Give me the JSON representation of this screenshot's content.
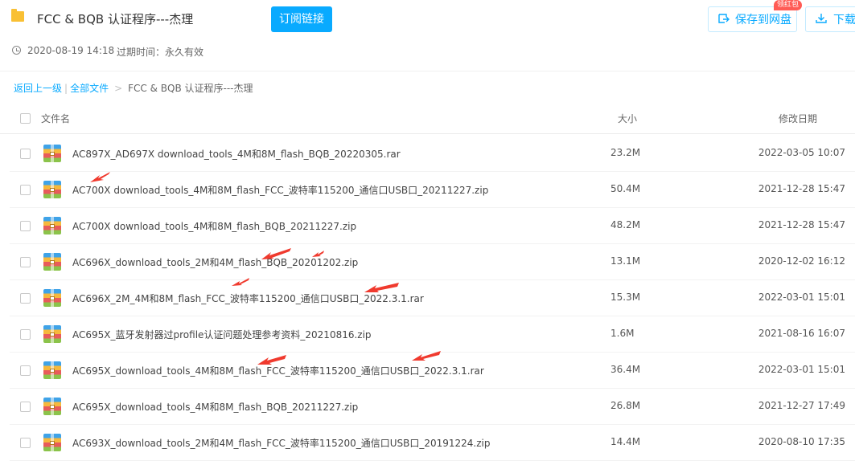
{
  "header": {
    "title": "FCC & BQB 认证程序---杰理",
    "subscribe_label": "订阅链接",
    "save_label": "保存到网盘",
    "badge_label": "领红包",
    "download_label": "下载"
  },
  "meta": {
    "share_time": "2020-08-19 14:18",
    "expire_label": "过期时间：",
    "expire_value": "永久有效"
  },
  "breadcrumb": {
    "back": "返回上一级",
    "all_files": "全部文件",
    "separator": "|",
    "arrow": ">",
    "current": "FCC & BQB 认证程序---杰理"
  },
  "columns": {
    "name": "文件名",
    "size": "大小",
    "date": "修改日期"
  },
  "files": [
    {
      "name": "AC897X_AD697X download_tools_4M和8M_flash_BQB_20220305.rar",
      "size": "23.2M",
      "date": "2022-03-05 10:07"
    },
    {
      "name": "AC700X download_tools_4M和8M_flash_FCC_波特率115200_通信口USB口_20211227.zip",
      "size": "50.4M",
      "date": "2021-12-28 15:47"
    },
    {
      "name": "AC700X download_tools_4M和8M_flash_BQB_20211227.zip",
      "size": "48.2M",
      "date": "2021-12-28 15:47"
    },
    {
      "name": "AC696X_download_tools_2M和4M_flash_BQB_20201202.zip",
      "size": "13.1M",
      "date": "2020-12-02 16:12"
    },
    {
      "name": "AC696X_2M_4M和8M_flash_FCC_波特率115200_通信口USB口_2022.3.1.rar",
      "size": "15.3M",
      "date": "2022-03-01 15:01"
    },
    {
      "name": "AC695X_蓝牙发射器过profile认证问题处理参考资料_20210816.zip",
      "size": "1.6M",
      "date": "2021-08-16 16:07"
    },
    {
      "name": "AC695X_download_tools_4M和8M_flash_FCC_波特率115200_通信口USB口_2022.3.1.rar",
      "size": "36.4M",
      "date": "2022-03-01 15:01"
    },
    {
      "name": "AC695X_download_tools_4M和8M_flash_BQB_20211227.zip",
      "size": "26.8M",
      "date": "2021-12-27 17:49"
    },
    {
      "name": "AC693X_download_tools_2M和4M_flash_FCC_波特率115200_通信口USB口_20191224.zip",
      "size": "14.4M",
      "date": "2020-08-10 17:35"
    }
  ],
  "colors": {
    "accent": "#09aaff",
    "annotation_arrow": "#f03a2e",
    "folder": "#f9c034",
    "badge": "#ff5b55"
  },
  "icons": {
    "folder": "folder-icon",
    "save": "save-to-cloud-icon",
    "download": "download-icon",
    "clock": "clock-icon",
    "file": "zip-archive-icon"
  }
}
